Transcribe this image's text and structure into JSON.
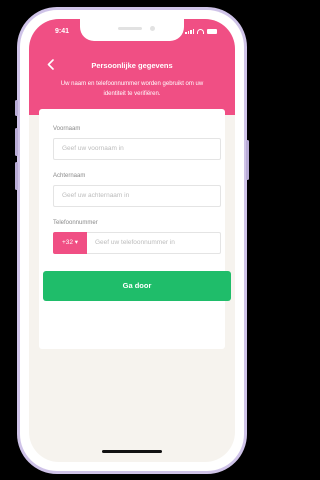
{
  "status_bar": {
    "time": "9:41"
  },
  "header": {
    "title": "Persoonlijke gegevens",
    "subtitle": "Uw naam en telefoonnummer worden gebruikt om uw identiteit te verifiëren."
  },
  "form": {
    "first_name": {
      "label": "Voornaam",
      "placeholder": "Geef uw voornaam in"
    },
    "last_name": {
      "label": "Achternaam",
      "placeholder": "Geef uw achternaam in"
    },
    "phone": {
      "label": "Telefoonnummer",
      "country_code": "+32 ▾",
      "placeholder": "Geef uw telefoonnummer in"
    }
  },
  "submit_label": "Ga door",
  "colors": {
    "brand_pink": "#f04f84",
    "action_green": "#1fbd6a",
    "background": "#f6f3ee"
  }
}
